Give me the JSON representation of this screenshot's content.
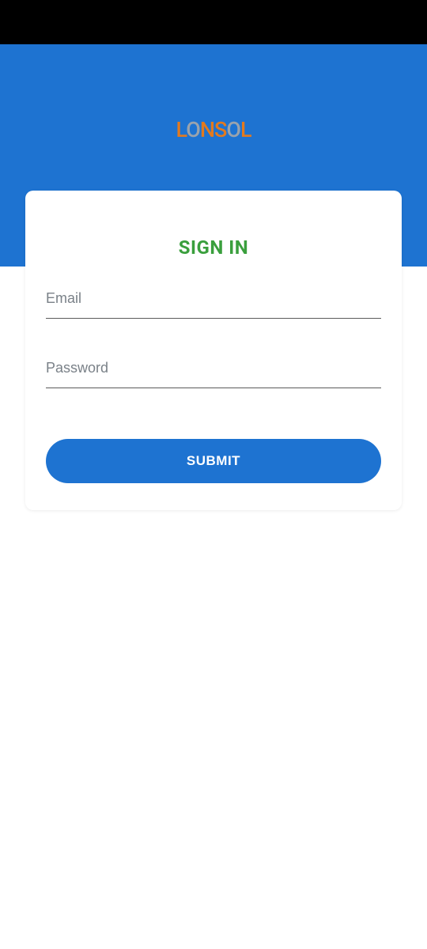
{
  "logo": {
    "text_parts": [
      "L",
      "O",
      "N",
      "S",
      "O",
      "L"
    ],
    "alt": "LONSOL"
  },
  "card": {
    "title": "SIGN IN",
    "email_placeholder": "Email",
    "email_value": "",
    "password_placeholder": "Password",
    "password_value": "",
    "submit_label": "SUBMIT"
  },
  "colors": {
    "primary": "#1e73d1",
    "accent_orange": "#e27a1f",
    "accent_green": "#3a9f3d"
  }
}
